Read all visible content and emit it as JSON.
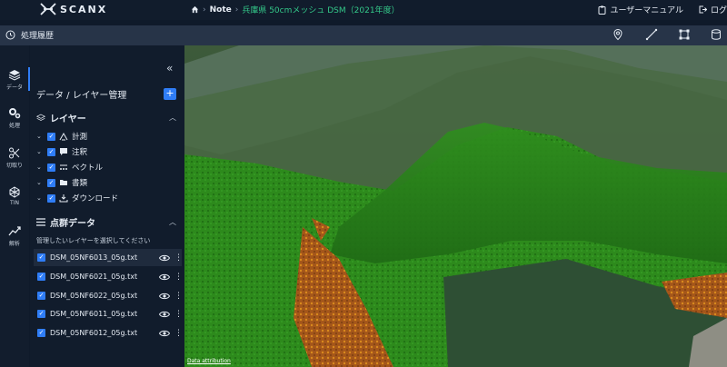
{
  "app": {
    "logo_text": "SCANX"
  },
  "breadcrumb": {
    "note": "Note",
    "page": "兵庫県 50cmメッシュ DSM（2021年度）"
  },
  "header": {
    "manual_label": "ユーザーマニュアル",
    "logout_label": "ログ"
  },
  "toolbar": {
    "history_label": "処理履歴"
  },
  "rail": {
    "items": [
      {
        "label": "データ",
        "icon": "layers-icon"
      },
      {
        "label": "処理",
        "icon": "gears-icon"
      },
      {
        "label": "切取り",
        "icon": "scissors-icon"
      },
      {
        "label": "TIN",
        "icon": "tin-icon"
      },
      {
        "label": "解析",
        "icon": "chart-icon"
      }
    ]
  },
  "panel": {
    "title": "データ / レイヤー管理",
    "add_label": "+",
    "layers_heading": "レイヤー",
    "layers": [
      {
        "label": "計測",
        "icon": "measure-icon"
      },
      {
        "label": "注釈",
        "icon": "comment-icon"
      },
      {
        "label": "ベクトル",
        "icon": "vector-icon"
      },
      {
        "label": "書類",
        "icon": "folder-icon"
      },
      {
        "label": "ダウンロード",
        "icon": "download-icon"
      }
    ],
    "pointcloud_heading": "点群データ",
    "pointcloud_hint": "管理したいレイヤーを選択してください",
    "pointcloud_files": [
      {
        "name": "DSM_05NF6013_05g.txt",
        "selected": true
      },
      {
        "name": "DSM_05NF6021_05g.txt",
        "selected": false
      },
      {
        "name": "DSM_05NF6022_05g.txt",
        "selected": false
      },
      {
        "name": "DSM_05NF6011_05g.txt",
        "selected": false
      },
      {
        "name": "DSM_05NF6012_05g.txt",
        "selected": false
      }
    ]
  },
  "map": {
    "attribution": "Data attribution"
  },
  "colors": {
    "accent": "#2f7df6",
    "breadcrumb_page": "#34c98a",
    "panel_bg": "#111c2c"
  }
}
